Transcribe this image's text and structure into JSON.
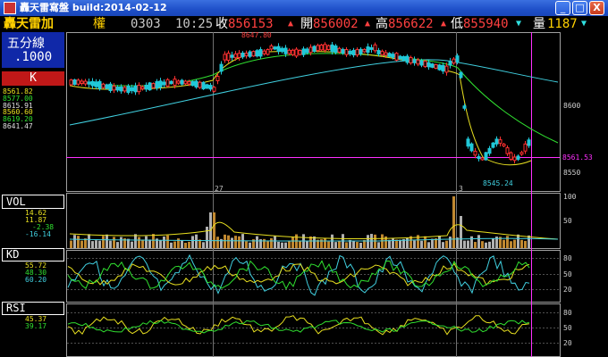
{
  "window": {
    "title": "轟天雷寫盤 build:2014-02-12",
    "minimize_glyph": "_",
    "maximize_glyph": "□",
    "close_glyph": "X"
  },
  "quote": {
    "name": "轟天雷加",
    "right_label": "權",
    "code": "0303",
    "time": "10:25",
    "close_label": "收",
    "close_value": "856153",
    "open_label": "開",
    "open_value": "856002",
    "high_label": "高",
    "high_value": "856622",
    "low_label": "低",
    "low_value": "855940",
    "volume_label": "量",
    "volume_value": "1187"
  },
  "panel": {
    "period": "五分線",
    "step": ".1000",
    "k_tab": "K",
    "ma_values": [
      "8561.82",
      "8577.00",
      "8615.91"
    ],
    "ma_values2": [
      "8560.60",
      "8619.20",
      "8641.47"
    ],
    "vol_tab": "VOL",
    "vol_values": [
      "14.62",
      "11.87",
      "-2.38",
      "-16.14"
    ],
    "kd_tab": "KD",
    "kd_values": [
      "55.72",
      "48.30",
      "60.20"
    ],
    "rsi_tab": "RSI",
    "rsi_values": [
      "45.37",
      "39.17"
    ]
  },
  "axes": {
    "price_ticks": [
      "8600",
      "8550"
    ],
    "current_price": "8561.53",
    "high_mark": "8647.80",
    "low_mark": "8545.24",
    "vol_ticks": [
      "100",
      "50"
    ],
    "kd_ticks": [
      "80",
      "50",
      "20"
    ],
    "rsi_ticks": [
      "80",
      "50",
      "20"
    ],
    "date_marks": [
      "27",
      "3"
    ]
  },
  "colors": {
    "up": "#ff3030",
    "down": "#20c8d8",
    "ma_short": "#e8e020",
    "ma_mid": "#30e030",
    "ma_long": "#40d0e0",
    "volume_bar": "#c08830",
    "grid": "#404040",
    "cursor": "#ff30ff"
  },
  "icons": {
    "app": "app-icon",
    "arrow_up": "arrow-up-icon",
    "arrow_down": "arrow-down-icon"
  }
}
